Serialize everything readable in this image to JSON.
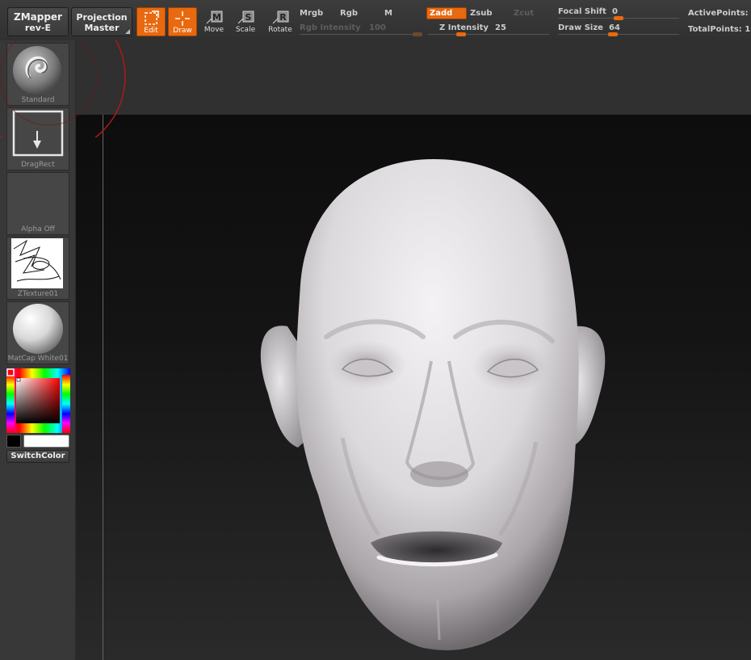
{
  "toolbar": {
    "zmapper": {
      "line1": "ZMapper",
      "line2": "rev-E"
    },
    "projection": {
      "line1": "Projection",
      "line2": "Master"
    },
    "tools": [
      {
        "name": "edit",
        "label": "Edit",
        "active": true
      },
      {
        "name": "draw",
        "label": "Draw",
        "active": true
      },
      {
        "name": "move",
        "label": "Move",
        "active": false
      },
      {
        "name": "scale",
        "label": "Scale",
        "active": false
      },
      {
        "name": "rotate",
        "label": "Rotate",
        "active": false
      }
    ],
    "color_modes": {
      "mrgb": "Mrgb",
      "rgb": "Rgb",
      "m": "M"
    },
    "rgb_intensity": {
      "label": "Rgb  Intensity",
      "value": "100",
      "level": 1.0
    },
    "z_modes": {
      "zadd": "Zadd",
      "zsub": "Zsub",
      "zcut": "Zcut"
    },
    "z_intensity": {
      "label": "Z  Intensity",
      "value": "25",
      "level": 0.25
    },
    "focal_shift": {
      "label": "Focal  Shift",
      "value": "0",
      "level": 0.5
    },
    "draw_size": {
      "label": "Draw  Size",
      "value": "64",
      "level": 0.45
    },
    "active_points": {
      "label": "ActivePoints:"
    },
    "total_points": {
      "label": "TotalPoints: 1"
    }
  },
  "shelf": {
    "brush": "Standard",
    "stroke": "DragRect",
    "alpha": "Alpha  Off",
    "texture": "ZTexture01",
    "material": "MatCap  White01",
    "switch_color": "SwitchColor"
  },
  "colors": {
    "accent": "#e8690f",
    "main_color": "#ffffff",
    "secondary_color": "#000000"
  }
}
